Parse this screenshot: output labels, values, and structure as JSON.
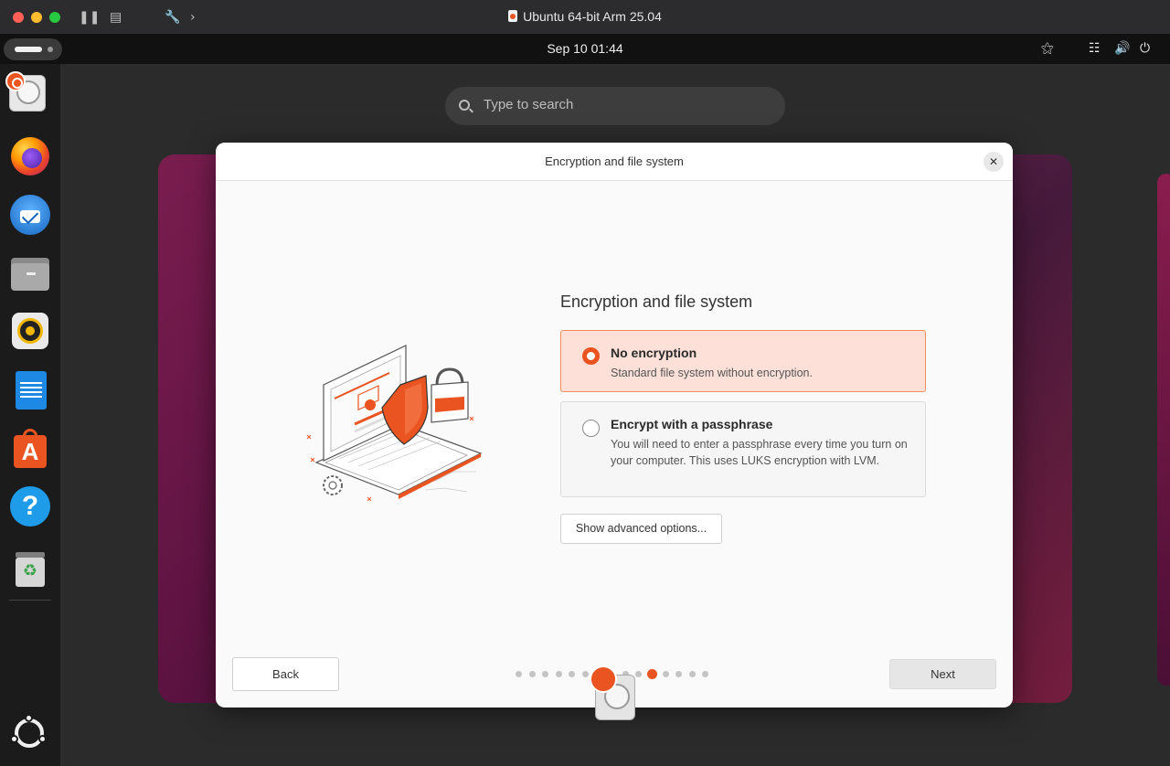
{
  "host_window": {
    "title": "Ubuntu 64-bit Arm 25.04"
  },
  "topbar": {
    "clock": "Sep 10  01:44"
  },
  "overview": {
    "search_placeholder": "Type to search"
  },
  "dock": {
    "items": [
      {
        "name": "installer",
        "icon": "disk-installer-icon"
      },
      {
        "name": "firefox",
        "icon": "firefox-icon"
      },
      {
        "name": "thunderbird",
        "icon": "thunderbird-icon"
      },
      {
        "name": "files",
        "icon": "files-icon"
      },
      {
        "name": "rhythmbox",
        "icon": "rhythmbox-icon"
      },
      {
        "name": "writer",
        "icon": "writer-icon"
      },
      {
        "name": "app-center",
        "icon": "app-center-icon"
      },
      {
        "name": "help",
        "icon": "help-icon"
      },
      {
        "name": "trash",
        "icon": "trash-icon"
      },
      {
        "name": "show-apps",
        "icon": "show-apps-icon"
      }
    ]
  },
  "dialog": {
    "header_title": "Encryption and file system",
    "close_label": "✕",
    "section_title": "Encryption and file system",
    "options": [
      {
        "label": "No encryption",
        "description": "Standard file system without encryption.",
        "selected": true
      },
      {
        "label": "Encrypt with a passphrase",
        "description": "You will need to enter a passphrase every time you turn on your computer. This uses LUKS encryption with LVM.",
        "selected": false
      }
    ],
    "advanced_button": "Show advanced options...",
    "back_button": "Back",
    "next_button": "Next",
    "progress": {
      "total_steps": 15,
      "current_step": 11
    }
  },
  "colors": {
    "accent": "#e95420",
    "selected_bg": "#fde0d8"
  }
}
